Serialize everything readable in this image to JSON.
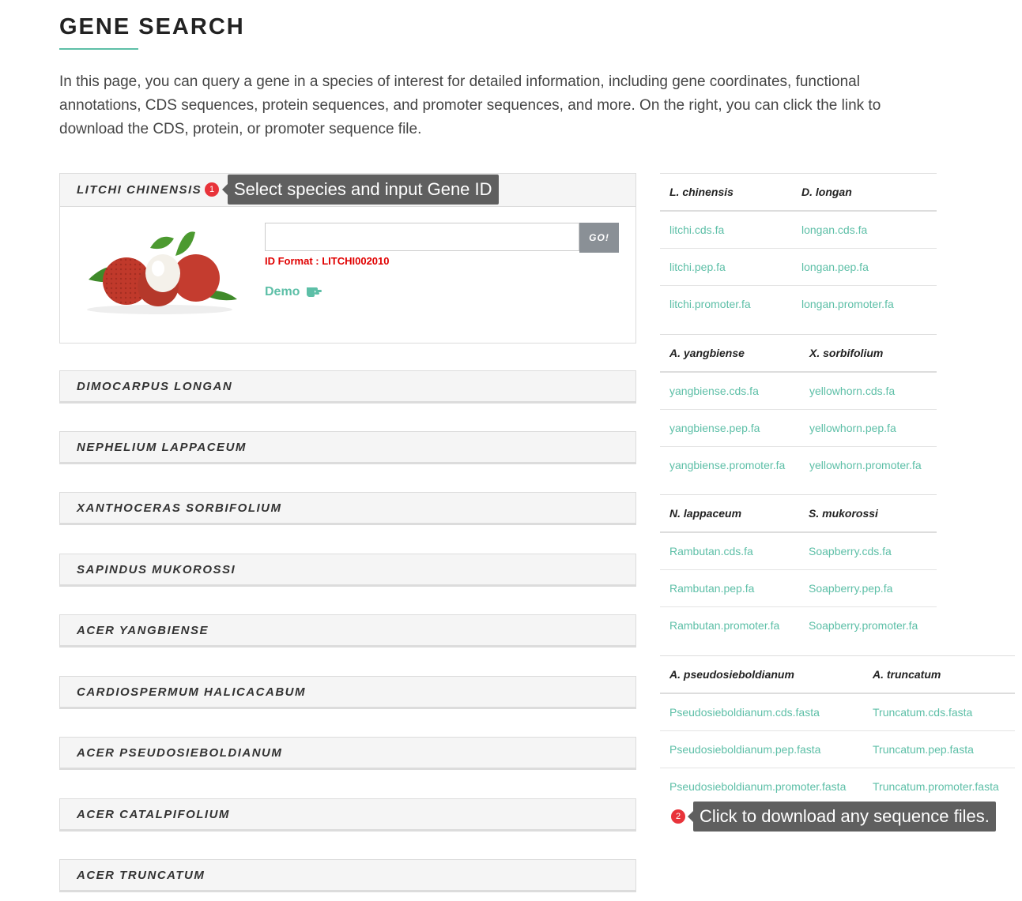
{
  "page": {
    "title": "GENE SEARCH",
    "intro": "In this page, you can query a gene in a species of interest for detailed information, including gene coordinates, functional annotations, CDS sequences, protein sequences, and promoter sequences, and more. On the right, you can click the link to download the CDS, protein, or promoter sequence file."
  },
  "species_panels": [
    {
      "label": "LITCHI CHINENSIS",
      "open": true
    },
    {
      "label": "DIMOCARPUS LONGAN"
    },
    {
      "label": "NEPHELIUM LAPPACEUM"
    },
    {
      "label": "XANTHOCERAS SORBIFOLIUM"
    },
    {
      "label": "SAPINDUS MUKOROSSI"
    },
    {
      "label": "ACER YANGBIENSE"
    },
    {
      "label": "CARDIOSPERMUM HALICACABUM"
    },
    {
      "label": "ACER PSEUDOSIEBOLDIANUM"
    },
    {
      "label": "ACER CATALPIFOLIUM"
    },
    {
      "label": "ACER TRUNCATUM"
    }
  ],
  "search": {
    "input_value": "",
    "go_label": "GO!",
    "id_format": "ID Format : LITCHI002010",
    "demo_label": "Demo"
  },
  "callouts": {
    "one": {
      "number": "1",
      "text": "Select species and input Gene ID"
    },
    "two": {
      "number": "2",
      "text": "Click to download any sequence files."
    }
  },
  "downloads": [
    {
      "species": [
        "L. chinensis",
        "D. longan"
      ],
      "rows": [
        [
          "litchi.cds.fa",
          "longan.cds.fa"
        ],
        [
          "litchi.pep.fa",
          "longan.pep.fa"
        ],
        [
          "litchi.promoter.fa",
          "longan.promoter.fa"
        ]
      ]
    },
    {
      "species": [
        "A. yangbiense",
        "X. sorbifolium"
      ],
      "rows": [
        [
          "yangbiense.cds.fa",
          "yellowhorn.cds.fa"
        ],
        [
          "yangbiense.pep.fa",
          "yellowhorn.pep.fa"
        ],
        [
          "yangbiense.promoter.fa",
          "yellowhorn.promoter.fa"
        ]
      ]
    },
    {
      "species": [
        "N. lappaceum",
        "S. mukorossi"
      ],
      "rows": [
        [
          "Rambutan.cds.fa",
          "Soapberry.cds.fa"
        ],
        [
          "Rambutan.pep.fa",
          "Soapberry.pep.fa"
        ],
        [
          "Rambutan.promoter.fa",
          "Soapberry.promoter.fa"
        ]
      ]
    },
    {
      "species": [
        "A. pseudosieboldianum",
        "A. truncatum"
      ],
      "rows": [
        [
          "Pseudosieboldianum.cds.fasta",
          "Truncatum.cds.fasta"
        ],
        [
          "Pseudosieboldianum.pep.fasta",
          "Truncatum.pep.fasta"
        ],
        [
          "Pseudosieboldianum.promoter.fasta",
          "Truncatum.promoter.fasta"
        ]
      ]
    }
  ],
  "colors": {
    "accent": "#5dbfa7",
    "error": "#e00000",
    "tooltip": "#5f5f5f",
    "badge": "#e8333a",
    "go_button": "#8a9096"
  }
}
